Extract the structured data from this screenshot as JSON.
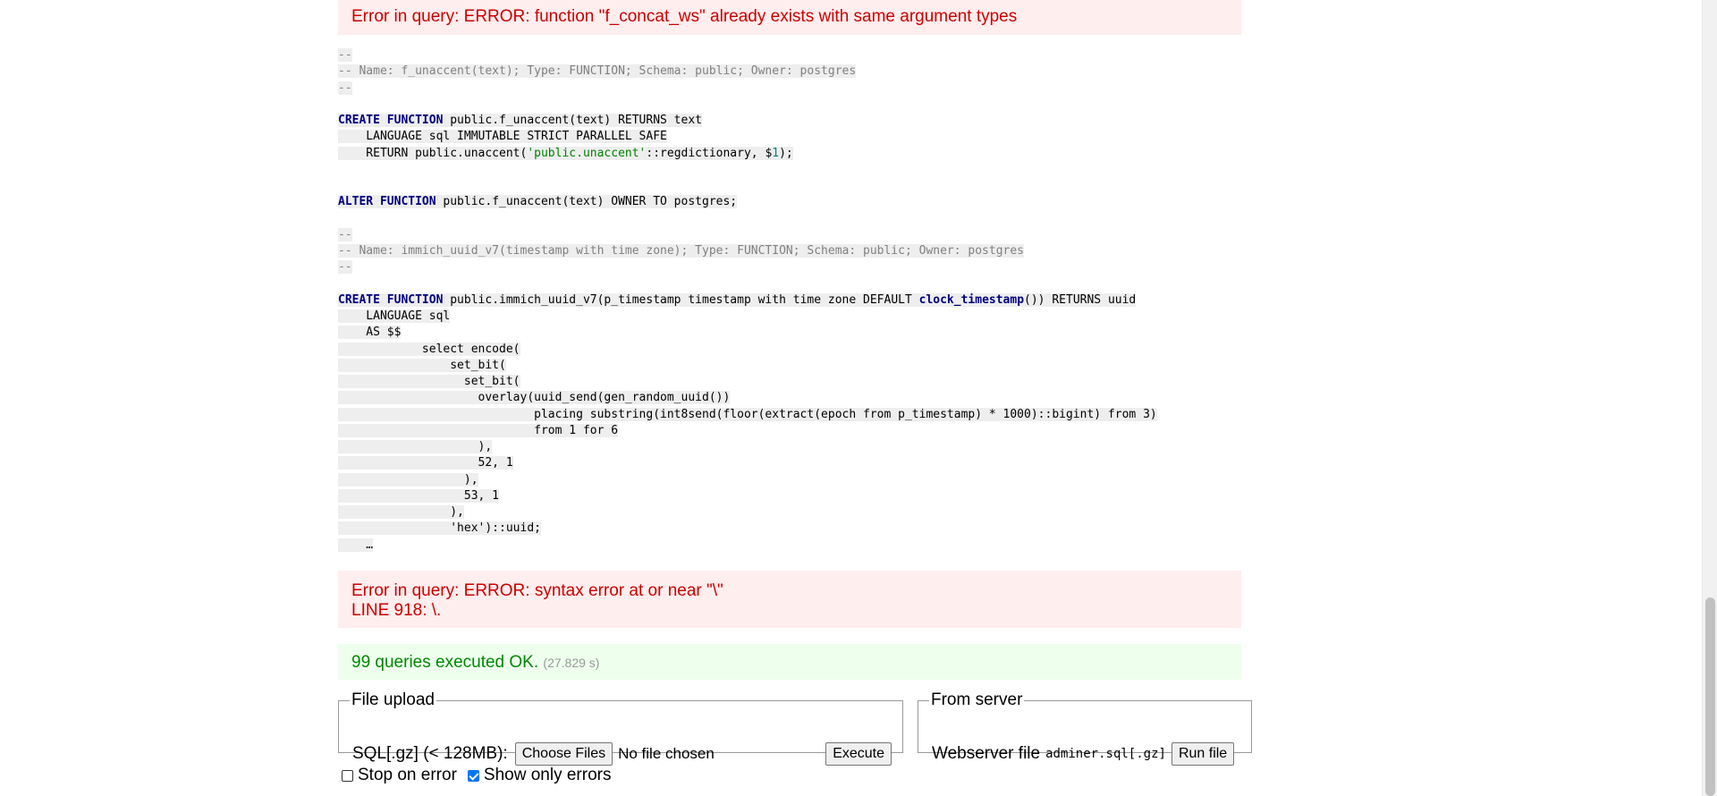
{
  "errors": {
    "first": "Error in query: ERROR: function \"f_concat_ws\" already exists with same argument types",
    "syntax_line1": "Error in query: ERROR: syntax error at or near \"\\\"",
    "syntax_line2": "LINE 918: \\."
  },
  "sql": {
    "c1": "--",
    "c2": "-- Name: f_unaccent(text); Type: FUNCTION; Schema: public; Owner: postgres",
    "c3": "--",
    "l1_kw": "CREATE FUNCTION",
    "l1_rest": " public.f_unaccent(text) RETURNS text",
    "l2": "    LANGUAGE sql IMMUTABLE STRICT PARALLEL SAFE",
    "l3_a": "    RETURN public.unaccent(",
    "l3_str": "'public.unaccent'",
    "l3_b": "::regdictionary, $",
    "l3_num": "1",
    "l3_c": ");",
    "alter_kw": "ALTER FUNCTION",
    "alter_rest": " public.f_unaccent(text) OWNER TO postgres;",
    "c4": "--",
    "c5": "-- Name: immich_uuid_v7(timestamp with time zone); Type: FUNCTION; Schema: public; Owner: postgres",
    "c6": "--",
    "l4_kw": "CREATE FUNCTION",
    "l4_a": " public.immich_uuid_v7(p_timestamp timestamp with time zone DEFAULT ",
    "l4_fn": "clock_timestamp",
    "l4_b": "()) RETURNS uuid",
    "b1": "    LANGUAGE sql",
    "b2": "    AS $$",
    "b3": "            select encode(",
    "b4": "                set_bit(",
    "b5": "                  set_bit(",
    "b6": "                    overlay(uuid_send(gen_random_uuid())",
    "b7": "                            placing substring(int8send(floor(extract(epoch from p_timestamp) * 1000)::bigint) from 3)",
    "b8": "                            from 1 for 6",
    "b9": "                    ),",
    "b10": "                    52, 1",
    "b11": "                  ),",
    "b12": "                  53, 1",
    "b13": "                ),",
    "b14": "                'hex')::uuid;",
    "b15": "    …"
  },
  "success": {
    "text": "99 queries executed OK.",
    "time": "(27.829 s)"
  },
  "file_upload": {
    "legend": "File upload",
    "label": "SQL[.gz] (< 128MB):",
    "choose_button": "Choose Files",
    "no_file": "No file chosen",
    "execute_button": "Execute"
  },
  "from_server": {
    "legend": "From server",
    "label": "Webserver file",
    "filename": "adminer.sql[.gz]",
    "run_button": "Run file"
  },
  "options": {
    "stop_on_error": "Stop on error",
    "stop_on_error_checked": false,
    "show_only_errors": "Show only errors",
    "show_only_errors_checked": true
  }
}
